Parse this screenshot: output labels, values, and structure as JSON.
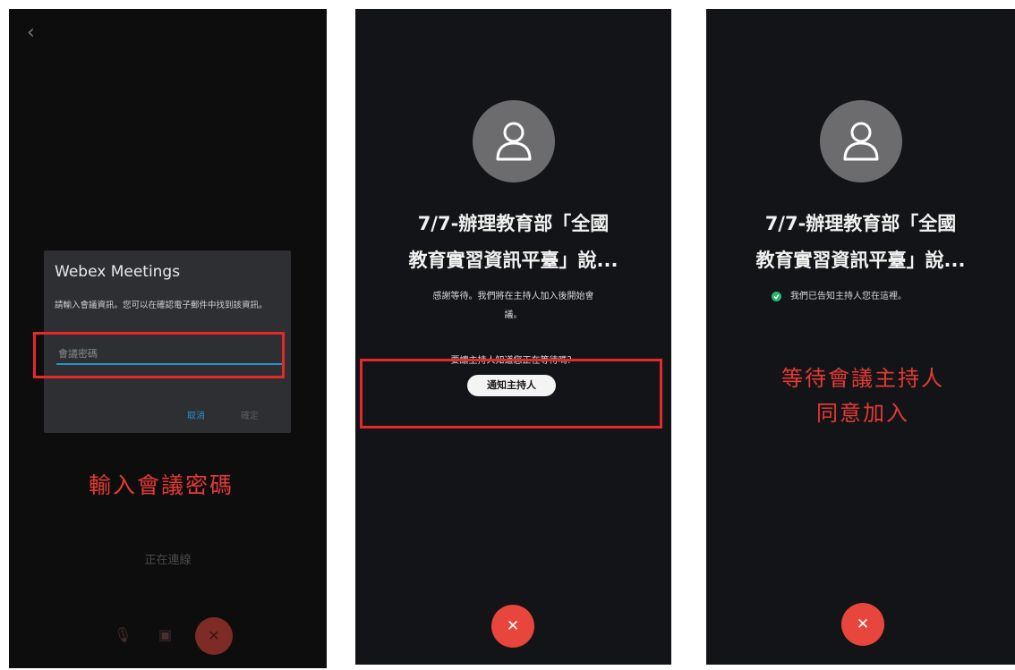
{
  "screen1": {
    "back_icon": "chevron-left-icon",
    "dialog": {
      "title": "Webex Meetings",
      "message": "請輸入會議資訊。您可以在確認電子郵件中找到該資訊。",
      "password_placeholder": "會議密碼",
      "cancel_label": "取消",
      "ok_label": "確定"
    },
    "status_text": "正在連線",
    "controls": [
      "mic-off-icon",
      "video-off-icon",
      "end-call-icon"
    ],
    "annotation": "輸入會議密碼"
  },
  "screen2": {
    "avatar_icon": "user-icon",
    "title_line1": "7/7-辦理教育部「全國",
    "title_line2": "教育實習資訊平臺」說...",
    "waiting_line1": "感謝等待。我們將在主持人加入後開始會",
    "waiting_line2": "議。",
    "ask_text": "要讓主持人知道您正在等待嗎？",
    "notify_label": "通知主持人",
    "end_icon": "end-call-icon"
  },
  "screen3": {
    "avatar_icon": "user-icon",
    "title_line1": "7/7-辦理教育部「全國",
    "title_line2": "教育實習資訊平臺」說...",
    "status_icon": "check-circle-icon",
    "status_text": "我們已告知主持人您在這裡。",
    "annotation_line1": "等待會議主持人",
    "annotation_line2": "同意加入",
    "end_icon": "end-call-icon"
  },
  "colors": {
    "highlight": "#e8272b",
    "annotation_text": "#e53935",
    "end_call": "#e8453c",
    "accent_blue": "#2b8fc9",
    "success": "#2bb673"
  }
}
